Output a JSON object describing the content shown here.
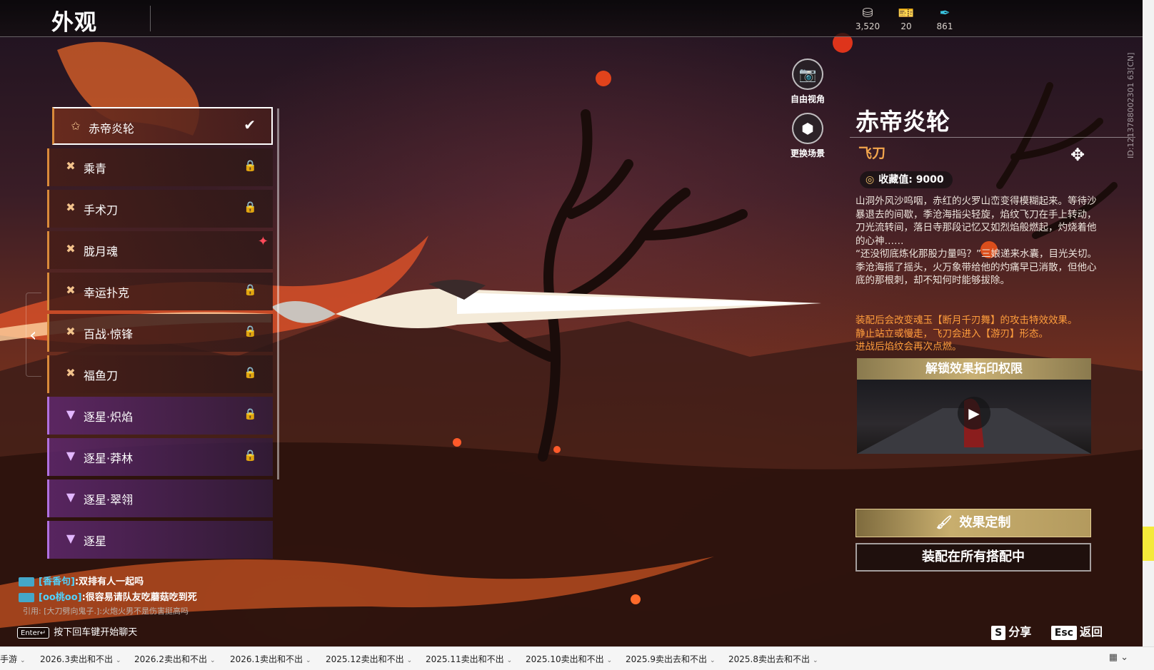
{
  "header": {
    "title": "外观",
    "currencies": [
      {
        "icon": "coin-stack-icon",
        "glyph": "⛁",
        "color": "#d9d2cc",
        "value": "3,520"
      },
      {
        "icon": "ticket-icon",
        "glyph": "🎫",
        "color": "#f0b73c",
        "value": "20"
      },
      {
        "icon": "feather-icon",
        "glyph": "✒",
        "color": "#39c4e0",
        "value": "861"
      }
    ]
  },
  "skins": [
    {
      "label": "赤帝炎轮",
      "status": "selected",
      "color": "orange"
    },
    {
      "label": "乘青",
      "status": "locked",
      "color": "orange"
    },
    {
      "label": "手术刀",
      "status": "locked",
      "color": "orange"
    },
    {
      "label": "胧月魂",
      "status": "new",
      "color": "orange"
    },
    {
      "label": "幸运扑克",
      "status": "locked",
      "color": "orange"
    },
    {
      "label": "百战·惊锋",
      "status": "locked",
      "color": "orange"
    },
    {
      "label": "福鱼刀",
      "status": "locked",
      "color": "orange"
    },
    {
      "label": "逐星·炽焰",
      "status": "locked",
      "color": "purple"
    },
    {
      "label": "逐星·莽林",
      "status": "locked",
      "color": "purple"
    },
    {
      "label": "逐星·翠翎",
      "status": "none",
      "color": "purple"
    },
    {
      "label": "逐星",
      "status": "none",
      "color": "purple"
    }
  ],
  "view_buttons": {
    "free_view": "自由视角",
    "change_scene": "更换场景"
  },
  "detail": {
    "name": "赤帝炎轮",
    "type": "飞刀",
    "collect_label": "收藏值: 9000",
    "description": [
      "山洞外风沙呜咽，赤红的火罗山峦变得模糊起来。等待沙暴退去的间歇，季沧海指尖轻旋，焰纹飞刀在手上转动，刀光流转间，落日寺那段记忆又如烈焰般燃起，灼烧着他的心神……",
      "“还没彻底炼化那股力量吗？”三娘递来水囊，目光关切。",
      "季沧海摇了摇头，火万象带给他的灼痛早已消散，但他心底的那根刺，却不知何时能够拔除。"
    ],
    "effect": [
      "装配后会改变魂玉【断月千刃舞】的攻击特效效果。",
      "静止站立或慢走，飞刀会进入【游刃】形态。",
      "进战后焰纹会再次点燃。"
    ],
    "unlock_label": "解锁效果拓印权限",
    "customize_label": "效果定制",
    "equip_all_label": "装配在所有搭配中"
  },
  "side_id": "ID:1213788002301 63[CN]",
  "chat": {
    "lines": [
      {
        "name": "[香香句]",
        "message": ":双排有人一起吗"
      },
      {
        "name": "[oo桃oo]",
        "message": ":很容易请队友吃蘑菇吃到死"
      }
    ],
    "quote": "引用: [大刀劈向鬼子.]:火炮火男不是伤害挺高吗",
    "enter_key": "Enter↵",
    "enter_hint": "按下回车键开始聊天"
  },
  "footer": {
    "share_key": "S",
    "share_label": "分享",
    "back_key": "Esc",
    "back_label": "返回"
  },
  "taskbar": {
    "items": [
      "手游",
      "2026.3卖出和不出",
      "2026.2卖出和不出",
      "2026.1卖出和不出",
      "2025.12卖出和不出",
      "2025.11卖出和不出",
      "2025.10卖出和不出",
      "2025.9卖出去和不出",
      "2025.8卖出去和不出"
    ]
  }
}
